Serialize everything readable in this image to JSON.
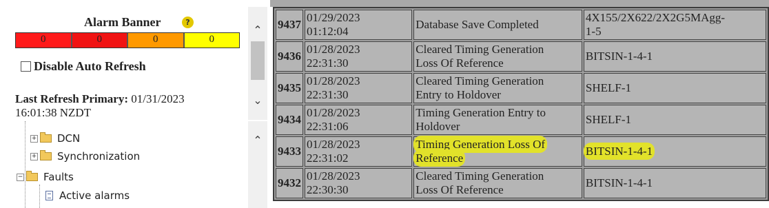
{
  "alarm_banner": {
    "title": "Alarm Banner",
    "help_icon": "help-icon",
    "counts": [
      {
        "severity": "critical",
        "value": "0",
        "color": "#ff1a1a"
      },
      {
        "severity": "major",
        "value": "0",
        "color": "#f01313"
      },
      {
        "severity": "minor",
        "value": "0",
        "color": "#ff9900"
      },
      {
        "severity": "warning",
        "value": "0",
        "color": "#ffff00"
      }
    ],
    "disable_auto_refresh_label": "Disable Auto Refresh",
    "disable_auto_refresh_checked": false,
    "last_refresh_label": "Last Refresh Primary:",
    "last_refresh_value_line1": "01/31/2023",
    "last_refresh_value_line2": "16:01:38 NZDT"
  },
  "tree": {
    "items": [
      {
        "label": "DCN",
        "icon": "folder-icon",
        "expanded": false
      },
      {
        "label": "Synchronization",
        "icon": "folder-icon",
        "expanded": false
      },
      {
        "label": "Faults",
        "icon": "open-folder-icon",
        "expanded": true
      },
      {
        "label": "Active alarms",
        "icon": "document-icon"
      }
    ]
  },
  "events": {
    "rows": [
      {
        "id": "9437",
        "date": "01/29/2023",
        "time": "01:12:04",
        "description": "Database Save Completed",
        "aid_line1": "4X155/2X622/2X2G5MAgg-",
        "aid_line2": "1-5",
        "highlighted": false
      },
      {
        "id": "9436",
        "date": "01/28/2023",
        "time": "22:31:30",
        "description_line1": "Cleared Timing Generation",
        "description_line2": "Loss Of Reference",
        "aid_line1": "BITSIN-1-4-1",
        "highlighted": false
      },
      {
        "id": "9435",
        "date": "01/28/2023",
        "time": "22:31:30",
        "description_line1": "Cleared Timing Generation",
        "description_line2": "Entry to Holdover",
        "aid_line1": "SHELF-1",
        "highlighted": false
      },
      {
        "id": "9434",
        "date": "01/28/2023",
        "time": "22:31:06",
        "description_line1": "Timing Generation Entry to",
        "description_line2": "Holdover",
        "aid_line1": "SHELF-1",
        "highlighted": false
      },
      {
        "id": "9433",
        "date": "01/28/2023",
        "time": "22:31:02",
        "description_line1": "Timing Generation Loss Of",
        "description_line2": "Reference",
        "aid_line1": "BITSIN-1-4-1",
        "highlighted": true,
        "highlight_color": "#e2e22a"
      },
      {
        "id": "9432",
        "date": "01/28/2023",
        "time": "22:30:30",
        "description_line1": "Cleared Timing Generation",
        "description_line2": "Loss Of Reference",
        "aid_line1": "BITSIN-1-4-1",
        "highlighted": false
      }
    ]
  }
}
